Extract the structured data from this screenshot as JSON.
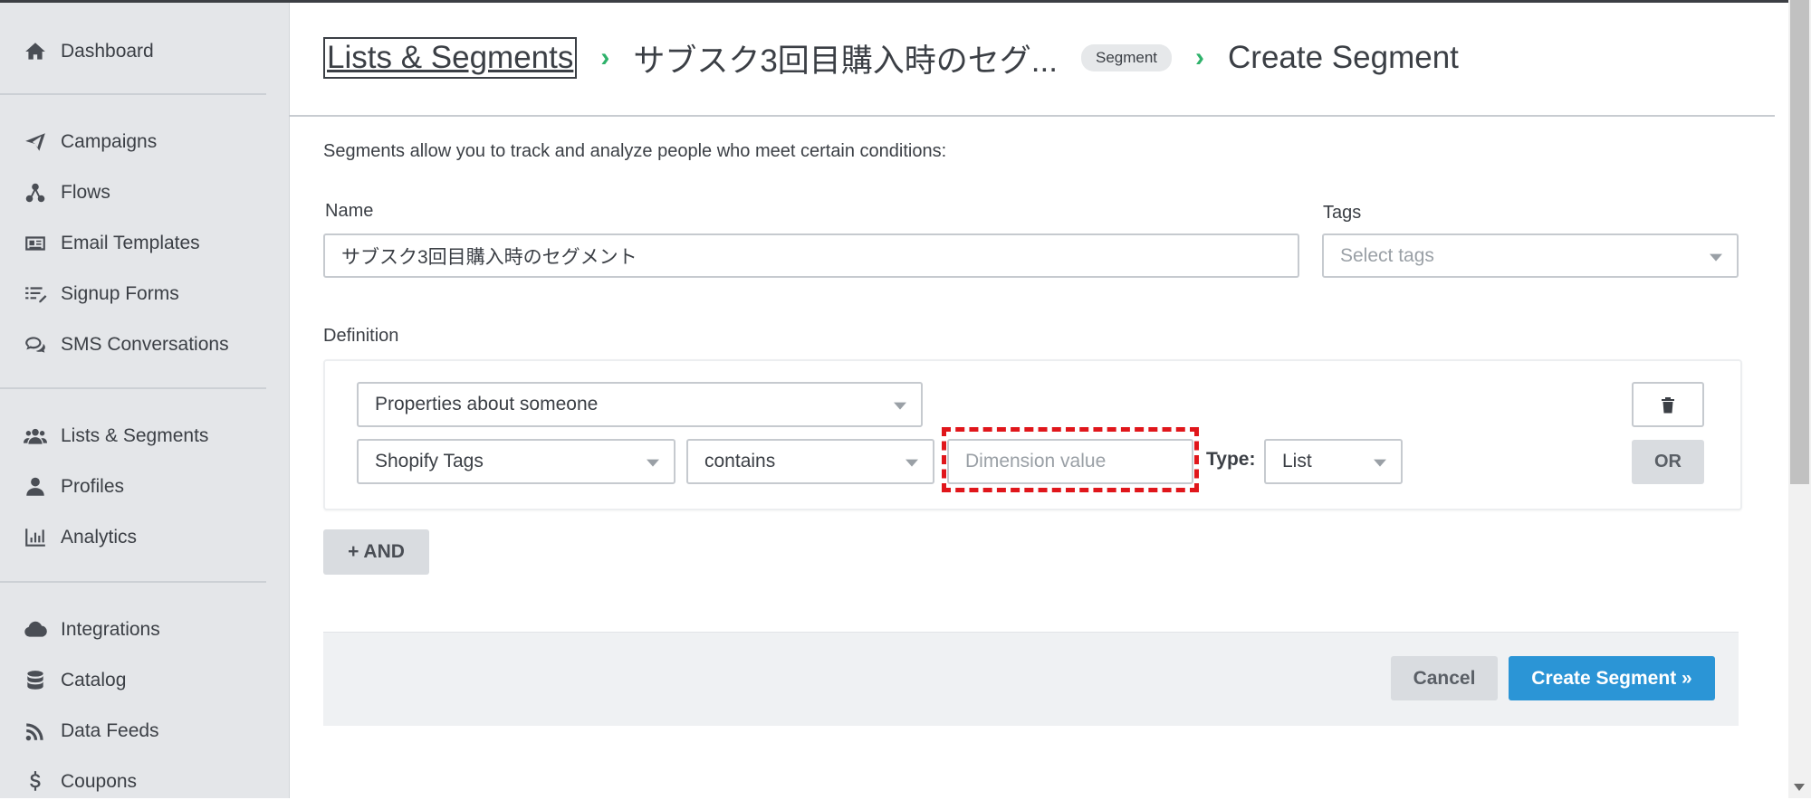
{
  "sidebar": {
    "items": [
      {
        "label": "Dashboard",
        "icon": "home-icon"
      },
      {
        "label": "Campaigns",
        "icon": "paper-plane-icon"
      },
      {
        "label": "Flows",
        "icon": "flows-icon"
      },
      {
        "label": "Email Templates",
        "icon": "newspaper-icon"
      },
      {
        "label": "Signup Forms",
        "icon": "form-list-icon"
      },
      {
        "label": "SMS Conversations",
        "icon": "chat-icon"
      },
      {
        "label": "Lists & Segments",
        "icon": "users-icon"
      },
      {
        "label": "Profiles",
        "icon": "user-icon"
      },
      {
        "label": "Analytics",
        "icon": "bar-chart-icon"
      },
      {
        "label": "Integrations",
        "icon": "cloud-icon"
      },
      {
        "label": "Catalog",
        "icon": "database-icon"
      },
      {
        "label": "Data Feeds",
        "icon": "rss-icon"
      },
      {
        "label": "Coupons",
        "icon": "dollar-icon"
      }
    ]
  },
  "header": {
    "breadcrumb_link": "Lists & Segments",
    "segment_name": "サブスク3回目購入時のセグ...",
    "badge": "Segment",
    "current": "Create Segment",
    "chevron": "›"
  },
  "form": {
    "description": "Segments allow you to track and analyze people who meet certain conditions:",
    "name_label": "Name",
    "name_value": "サブスク3回目購入時のセグメント",
    "tags_label": "Tags",
    "tags_placeholder": "Select tags",
    "definition_label": "Definition"
  },
  "definition": {
    "condition_type": "Properties about someone",
    "property": "Shopify Tags",
    "operator": "contains",
    "value_placeholder": "Dimension value",
    "type_label": "Type:",
    "type_value": "List",
    "or_label": "OR",
    "and_label": "+ AND"
  },
  "actions": {
    "cancel": "Cancel",
    "create": "Create Segment »"
  },
  "colors": {
    "accent": "#2b95d6",
    "chevron": "#2fb26b",
    "highlight": "#e0161b"
  }
}
